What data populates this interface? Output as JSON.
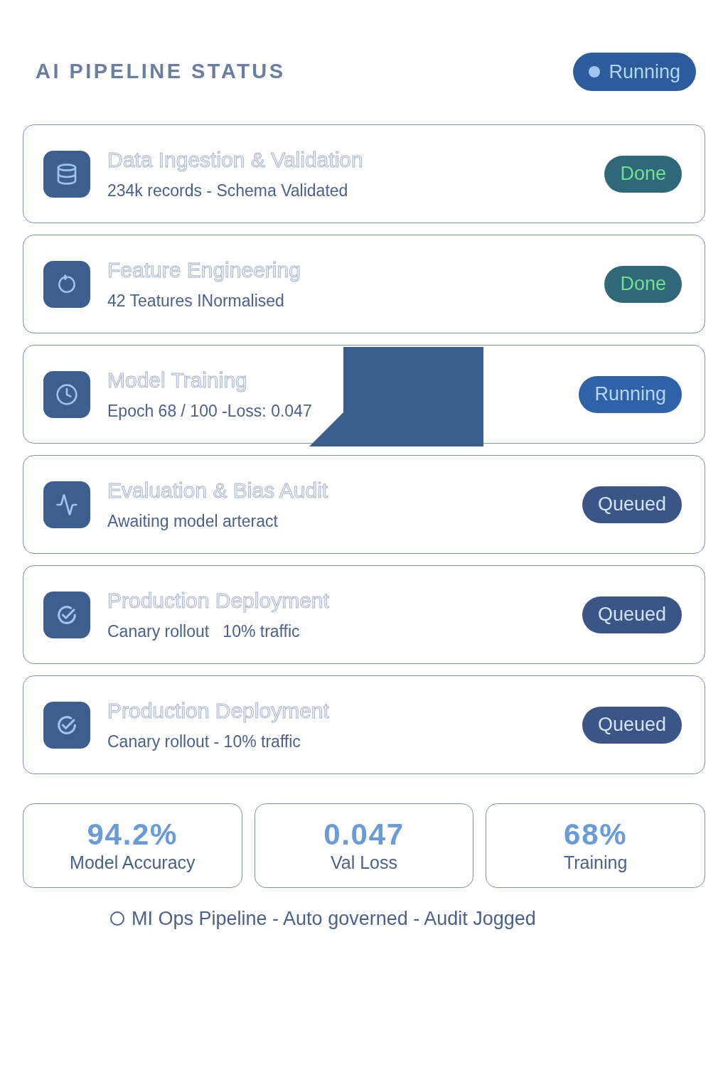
{
  "header": {
    "title": "AI PIPELINE STATUS",
    "status": {
      "label": "Running",
      "kind": "running"
    }
  },
  "stages": [
    {
      "title": "Data Ingestion & Validation",
      "detail": "234k records - Schema Validated",
      "status": {
        "label": "Done",
        "kind": "done"
      }
    },
    {
      "title": "Feature Engineering",
      "detail": "42 Teatures INormalised",
      "status": {
        "label": "Done",
        "kind": "done"
      }
    },
    {
      "title": "Model Training",
      "detail": "Epoch 68 / 100 -Loss: 0.047",
      "status": {
        "label": "Running",
        "kind": "running"
      }
    },
    {
      "title": "Evaluation & Bias Audit",
      "detail": "Awaiting model arteract",
      "status": {
        "label": "Queued",
        "kind": "queued"
      }
    },
    {
      "title": "Production Deployment",
      "detail": "Canary rollout   10% traffic",
      "status": {
        "label": "Queued",
        "kind": "queued"
      }
    },
    {
      "title": "Production Deployment",
      "detail": "Canary rollout - 10% traffic",
      "status": {
        "label": "Queued",
        "kind": "queued"
      }
    }
  ],
  "stats": [
    {
      "value": "94.2%",
      "label": "Model Accuracy"
    },
    {
      "value": "0.047",
      "label": "Val Loss"
    },
    {
      "value": "68%",
      "label": "Training"
    }
  ],
  "footer": {
    "text": "MI Ops Pipeline - Auto governed - Audit Jogged"
  }
}
